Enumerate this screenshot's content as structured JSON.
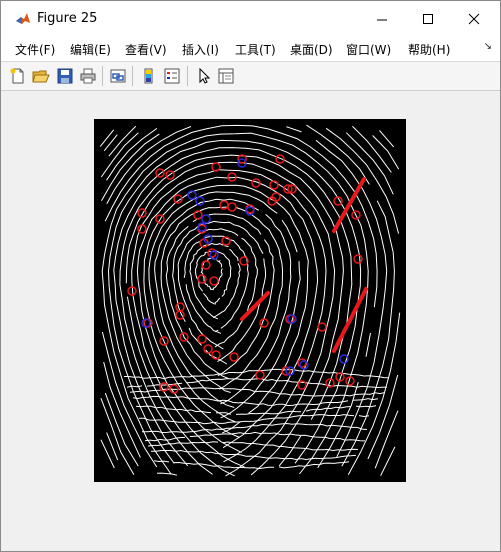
{
  "window": {
    "title": "Figure 25",
    "controls": [
      "minimize",
      "maximize",
      "close"
    ]
  },
  "menu": {
    "items": [
      "文件(F)",
      "编辑(E)",
      "查看(V)",
      "插入(I)",
      "工具(T)",
      "桌面(D)",
      "窗口(W)",
      "帮助(H)"
    ]
  },
  "toolbar": {
    "icons": [
      "new-figure-icon",
      "open-file-icon",
      "save-icon",
      "print-icon",
      "link-icon",
      "colorbar-icon",
      "legend-icon",
      "pointer-icon",
      "property-inspector-icon"
    ]
  },
  "plot": {
    "description_colors": {
      "background": "#000000",
      "ridges": "#ffffff",
      "minutiae": "#e8191b",
      "markers": "#2a2ad8"
    }
  }
}
